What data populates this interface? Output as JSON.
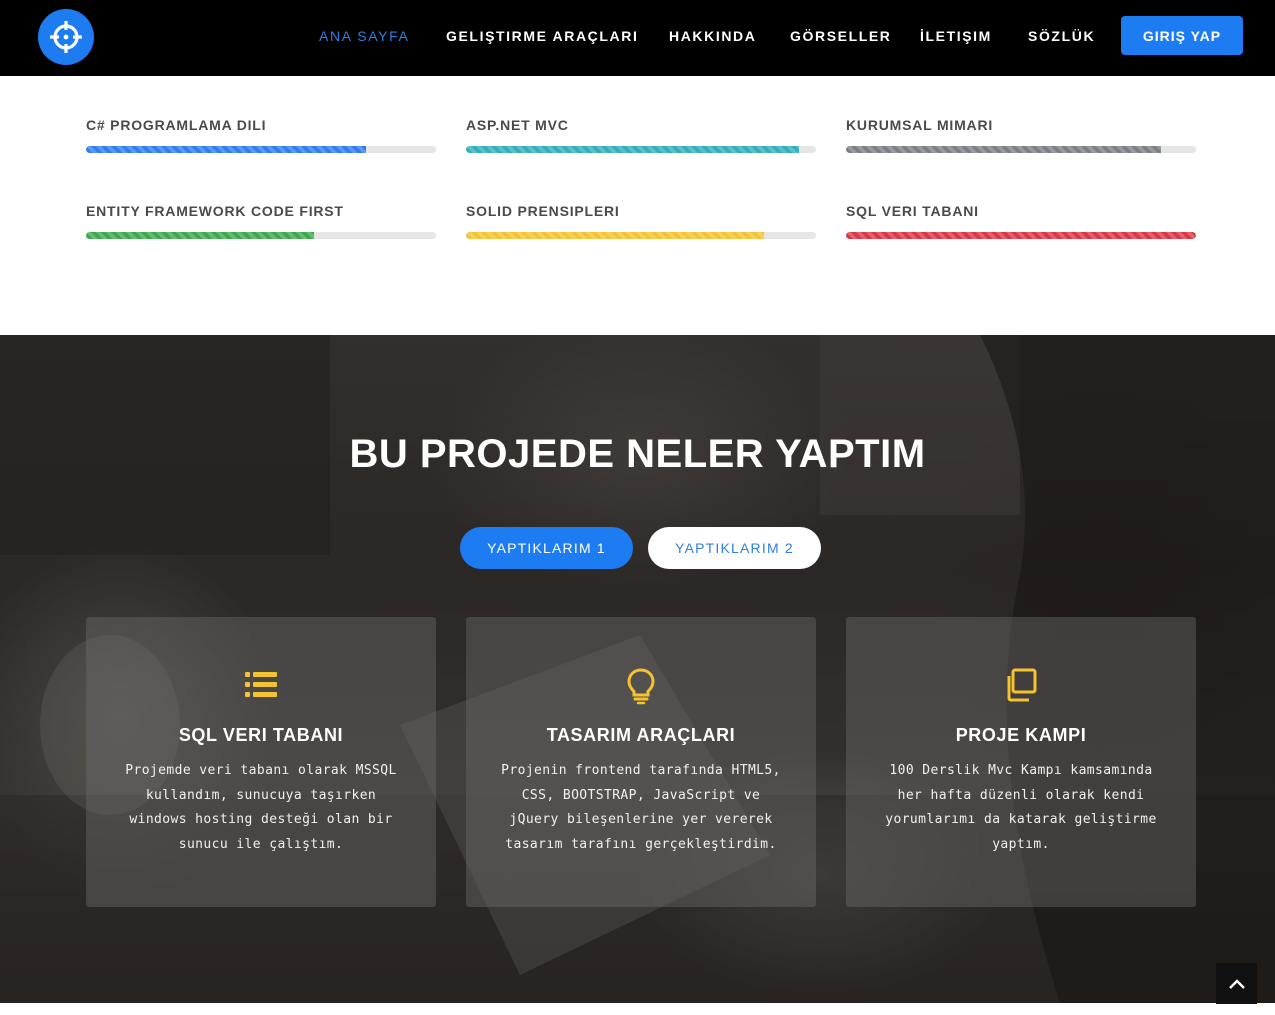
{
  "header": {
    "logo_icon": "crosshair-icon",
    "nav": [
      {
        "label": "ANA SAYFA",
        "active": true
      },
      {
        "label": "GELIŞTIRME ARAÇLARI",
        "active": false
      },
      {
        "label": "HAKKINDA",
        "active": false
      },
      {
        "label": "GÖRSELLER",
        "active": false
      },
      {
        "label": "İLETIŞIM",
        "active": false
      },
      {
        "label": "SÖZLÜK",
        "active": false
      }
    ],
    "login_label": "GIRIŞ YAP",
    "accent_color": "#1e7cf2"
  },
  "skills": [
    {
      "label": "C# PROGRAMLAMA DILI",
      "percent": 80,
      "color": "#2f7cf6"
    },
    {
      "label": "ASP.NET MVC",
      "percent": 95,
      "color": "#31aebc"
    },
    {
      "label": "KURUMSAL MIMARI",
      "percent": 90,
      "color": "#7b7f84"
    },
    {
      "label": "ENTITY FRAMEWORK CODE FIRST",
      "percent": 65,
      "color": "#3ba84a"
    },
    {
      "label": "SOLID PRENSIPLERI",
      "percent": 85,
      "color": "#f5c230"
    },
    {
      "label": "SQL VERI TABANI",
      "percent": 100,
      "color": "#dc3545"
    }
  ],
  "projects": {
    "title": "BU PROJEDE NELER YAPTIM",
    "tabs": [
      "YAPTIKLARIM 1",
      "YAPTIKLARIM 2"
    ],
    "icon_color": "#f5c230",
    "cards": [
      {
        "icon": "list-icon",
        "title": "SQL VERI TABANI",
        "text": "Projemde veri tabanı olarak MSSQL kullandım, sunucuya taşırken windows hosting desteği olan bir sunucu ile çalıştım."
      },
      {
        "icon": "lightbulb-icon",
        "title": "TASARIM ARAÇLARI",
        "text": "Projenin frontend tarafında HTML5, CSS, BOOTSTRAP, JavaScript ve jQuery bileşenlerine yer vererek tasarım tarafını gerçekleştirdim."
      },
      {
        "icon": "copy-icon",
        "title": "PROJE KAMPI",
        "text": "100 Derslik Mvc Kampı kamsamında her hafta düzenli olarak kendi yorumlarımı da katarak geliştirme yaptım."
      }
    ]
  },
  "back_to_top_icon": "chevron-up-icon"
}
